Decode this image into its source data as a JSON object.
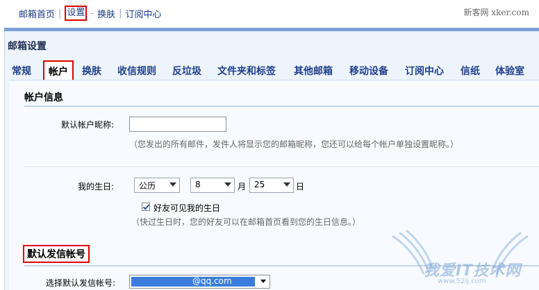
{
  "topnav": {
    "links": [
      "邮箱首页",
      "设置",
      "换肤",
      "订阅中心"
    ],
    "right_text": "新客网 xker.com"
  },
  "page": {
    "title": "邮箱设置"
  },
  "tabs": [
    {
      "label": "常规",
      "active": false
    },
    {
      "label": "帐户",
      "active": true
    },
    {
      "label": "换肤",
      "active": false
    },
    {
      "label": "收信规则",
      "active": false
    },
    {
      "label": "反垃圾",
      "active": false
    },
    {
      "label": "文件夹和标签",
      "active": false
    },
    {
      "label": "其他邮箱",
      "active": false
    },
    {
      "label": "移动设备",
      "active": false
    },
    {
      "label": "订阅中心",
      "active": false
    },
    {
      "label": "信纸",
      "active": false
    },
    {
      "label": "体验室",
      "active": false
    }
  ],
  "account_info": {
    "title": "帐户信息",
    "nickname_label": "默认帐户昵称:",
    "nickname_value": "",
    "nickname_hint": "（您发出的所有邮件，发件人将显示您的邮箱昵称，您还可以给每个帐户单独设置昵称。）",
    "birthday_label": "我的生日:",
    "calendar_value": "公历",
    "month_value": "8",
    "month_unit": "月",
    "day_value": "25",
    "day_unit": "日",
    "friends_visible_label": "好友可见我的生日",
    "friends_visible_checked": true,
    "birthday_hint": "（快过生日时，您的好友可以在邮箱首页看到您的生日信息。）"
  },
  "default_sender": {
    "title": "默认发信帐号",
    "select_label": "选择默认发信帐号:",
    "select_value": "@qq.com"
  },
  "watermark": {
    "text": "我爱IT技术网",
    "url": "www.52ij.com"
  },
  "colors": {
    "accent_blue": "#7aa2d6",
    "link_blue": "#1a3a88",
    "highlight_red": "#e00000"
  }
}
